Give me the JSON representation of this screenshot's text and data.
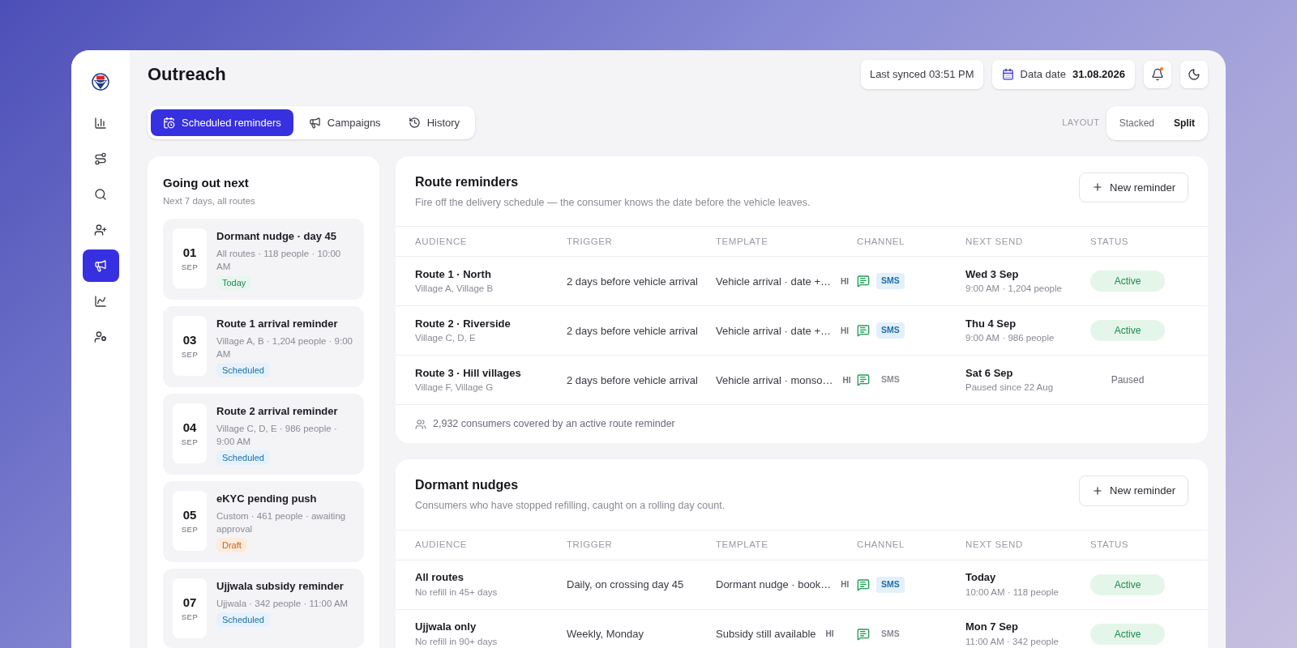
{
  "sidebar": {
    "items": [
      {
        "kind": "chart",
        "selected": false
      },
      {
        "kind": "route",
        "selected": false
      },
      {
        "kind": "search",
        "selected": false
      },
      {
        "kind": "user-plus",
        "selected": false
      },
      {
        "kind": "megaphone",
        "selected": true
      },
      {
        "kind": "trend",
        "selected": false
      },
      {
        "kind": "user-cog",
        "selected": false
      }
    ]
  },
  "header": {
    "title": "Outreach",
    "sync": "Last synced 03:51 PM",
    "date_label": "Data date",
    "date_value": "31.08.2026",
    "notifications_unread": true
  },
  "tabs": [
    {
      "kind": "calendar",
      "label": "Scheduled reminders",
      "selected": true
    },
    {
      "kind": "megaphone",
      "label": "Campaigns",
      "selected": false
    },
    {
      "kind": "history",
      "label": "History",
      "selected": false
    }
  ],
  "layout_toggle": {
    "label": "LAYOUT",
    "options": [
      {
        "label": "Stacked",
        "selected": false
      },
      {
        "label": "Split",
        "selected": true
      }
    ]
  },
  "upcoming": {
    "title": "Going out next",
    "subtitle": "Next 7 days, all routes",
    "items": [
      {
        "day": "01",
        "month": "SEP",
        "title": "Dormant nudge · day 45",
        "detail": "All routes · 118 people · 10:00 AM",
        "badge": "Today",
        "kind": "today"
      },
      {
        "day": "03",
        "month": "SEP",
        "title": "Route 1 arrival reminder",
        "detail": "Village A, B · 1,204 people · 9:00 AM",
        "badge": "Scheduled",
        "kind": "scheduled"
      },
      {
        "day": "04",
        "month": "SEP",
        "title": "Route 2 arrival reminder",
        "detail": "Village C, D, E · 986 people · 9:00 AM",
        "badge": "Scheduled",
        "kind": "scheduled"
      },
      {
        "day": "05",
        "month": "SEP",
        "title": "eKYC pending push",
        "detail": "Custom · 461 people · awaiting approval",
        "badge": "Draft",
        "kind": "draft"
      },
      {
        "day": "07",
        "month": "SEP",
        "title": "Ujjwala subsidy reminder",
        "detail": "Ujjwala · 342 people · 11:00 AM",
        "badge": "Scheduled",
        "kind": "scheduled"
      }
    ]
  },
  "sections": [
    {
      "title": "Route reminders",
      "subtitle": "Fire off the delivery schedule — the consumer knows the date before the vehicle leaves.",
      "button": "New reminder",
      "columns": [
        "AUDIENCE",
        "TRIGGER",
        "TEMPLATE",
        "CHANNEL",
        "NEXT SEND",
        "STATUS"
      ],
      "rows": [
        {
          "audience": "Route 1 · North",
          "audience_detail": "Village A, Village B",
          "trigger": "2 days before vehicle arrival",
          "template": "Vehicle arrival · date +…",
          "language": "HI",
          "channel": "SMS",
          "channel_active": true,
          "next": "Wed 3 Sep",
          "next_detail": "9:00 AM · 1,204 people",
          "status": "Active",
          "kind": "active"
        },
        {
          "audience": "Route 2 · Riverside",
          "audience_detail": "Village C, D, E",
          "trigger": "2 days before vehicle arrival",
          "template": "Vehicle arrival · date +…",
          "language": "HI",
          "channel": "SMS",
          "channel_active": true,
          "next": "Thu 4 Sep",
          "next_detail": "9:00 AM · 986 people",
          "status": "Active",
          "kind": "active"
        },
        {
          "audience": "Route 3 · Hill villages",
          "audience_detail": "Village F, Village G",
          "trigger": "2 days before vehicle arrival",
          "template": "Vehicle arrival · monso…",
          "language": "HI",
          "channel": "SMS",
          "channel_active": false,
          "next": "Sat 6 Sep",
          "next_detail": "Paused since 22 Aug",
          "status": "Paused",
          "kind": "paused"
        }
      ],
      "footer": "2,932 consumers covered by an active route reminder"
    },
    {
      "title": "Dormant nudges",
      "subtitle": "Consumers who have stopped refilling, caught on a rolling day count.",
      "button": "New reminder",
      "columns": [
        "AUDIENCE",
        "TRIGGER",
        "TEMPLATE",
        "CHANNEL",
        "NEXT SEND",
        "STATUS"
      ],
      "rows": [
        {
          "audience": "All routes",
          "audience_detail": "No refill in 45+ days",
          "trigger": "Daily, on crossing day 45",
          "template": "Dormant nudge · book…",
          "language": "HI",
          "channel": "SMS",
          "channel_active": true,
          "next": "Today",
          "next_detail": "10:00 AM · 118 people",
          "status": "Active",
          "kind": "active"
        },
        {
          "audience": "Ujjwala only",
          "audience_detail": "No refill in 90+ days",
          "trigger": "Weekly, Monday",
          "template": "Subsidy still available",
          "language": "HI",
          "channel": "SMS",
          "channel_active": false,
          "next": "Mon 7 Sep",
          "next_detail": "11:00 AM · 342 people",
          "status": "Active",
          "kind": "active"
        }
      ]
    }
  ]
}
